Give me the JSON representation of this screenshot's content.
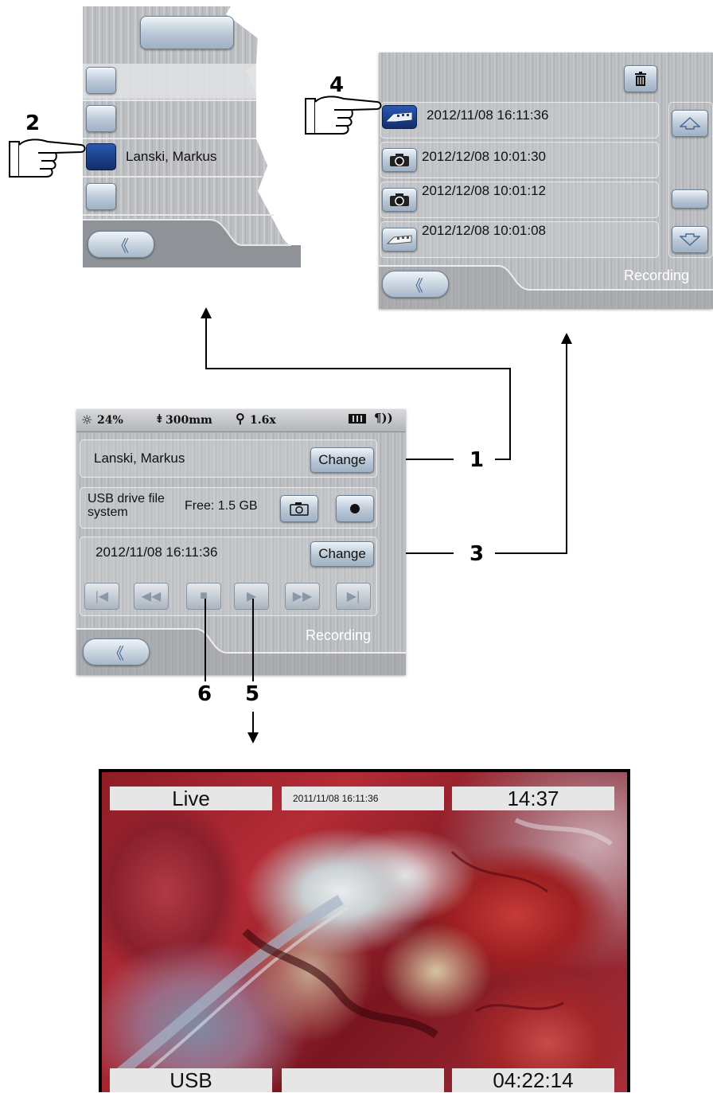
{
  "top_left_panel": {
    "selected_user": "Lanski, Markus"
  },
  "top_right_panel": {
    "entries": [
      {
        "datetime": "2012/11/08 16:11:36",
        "icon": "video-film-icon",
        "selected": true
      },
      {
        "datetime": "2012/12/08 10:01:30",
        "icon": "camera-icon",
        "selected": false
      },
      {
        "datetime": "2012/12/08 10:01:12",
        "icon": "camera-icon",
        "selected": false
      },
      {
        "datetime": "2012/12/08 10:01:08",
        "icon": "video-film-icon",
        "selected": false
      }
    ],
    "footer_label": "Recording",
    "delete_icon": "trash-icon"
  },
  "callouts": {
    "n1": "1",
    "n2": "2",
    "n3": "3",
    "n4": "4",
    "n5": "5",
    "n6": "6"
  },
  "main_panel": {
    "status_bar": {
      "light": "24%",
      "distance": "300mm",
      "zoom": "1.6x"
    },
    "user_name": "Lanski, Markus",
    "change_label": "Change",
    "storage_label": "USB drive file system",
    "free_label": "Free: 1.5 GB",
    "recording_datetime": "2012/11/08 16:11:36",
    "change_label_2": "Change",
    "footer_label": "Recording"
  },
  "video_view": {
    "top_left": "Live",
    "top_center": "2011/11/08 16:11:36",
    "top_right": "14:37",
    "bottom_left": "USB",
    "bottom_center": "",
    "bottom_right": "04:22:14"
  }
}
